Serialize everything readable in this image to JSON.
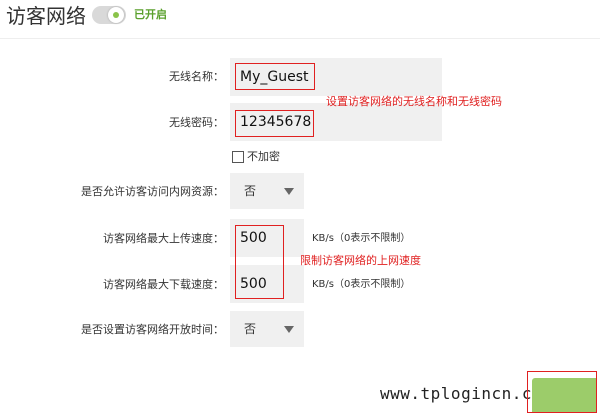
{
  "header": {
    "title": "访客网络",
    "status": "已开启"
  },
  "form": {
    "ssid_label": "无线名称：",
    "ssid_value": "My_Guest",
    "password_label": "无线密码：",
    "password_value": "12345678",
    "no_encrypt_label": "不加密",
    "intranet_label": "是否允许访客访问内网资源：",
    "intranet_value": "否",
    "upload_label": "访客网络最大上传速度：",
    "upload_value": "500",
    "upload_unit": "KB/s（0表示不限制）",
    "download_label": "访客网络最大下载速度：",
    "download_value": "500",
    "download_unit": "KB/s（0表示不限制）",
    "schedule_label": "是否设置访客网络开放时间：",
    "schedule_value": "否"
  },
  "annotations": {
    "wifi_note": "设置访客网络的无线名称和无线密码",
    "speed_note": "限制访客网络的上网速度"
  },
  "watermark": "www.tplogincn.com",
  "colors": {
    "accent_green": "#8ac34a",
    "annotation_red": "#e02020",
    "field_bg": "#f0f0f0"
  }
}
